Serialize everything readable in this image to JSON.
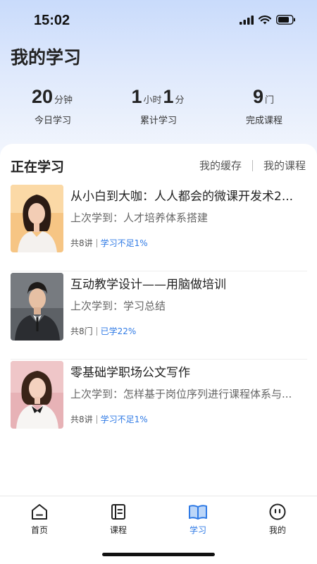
{
  "status_bar": {
    "time": "15:02"
  },
  "page_title": "我的学习",
  "stats": [
    {
      "parts": [
        {
          "num": "20"
        },
        {
          "unit": "分钟"
        }
      ],
      "label": "今日学习"
    },
    {
      "parts": [
        {
          "num": "1"
        },
        {
          "unit": "小时"
        },
        {
          "num": "1"
        },
        {
          "unit": "分"
        }
      ],
      "label": "累计学习"
    },
    {
      "parts": [
        {
          "num": "9"
        },
        {
          "unit": "门"
        }
      ],
      "label": "完成课程"
    }
  ],
  "section": {
    "title": "正在学习",
    "links": [
      "我的缓存",
      "我的课程"
    ]
  },
  "courses": [
    {
      "title": "从小白到大咖：人人都会的微课开发术2...",
      "last": "上次学到：人才培养体系搭建",
      "count": "共8讲",
      "progress": "学习不足1%",
      "thumb_bg": "#f7c98a"
    },
    {
      "title": "互动教学设计——用脑做培训",
      "last": "上次学到：学习总结",
      "count": "共8门",
      "progress": "已学22%",
      "thumb_bg": "#6c7075"
    },
    {
      "title": "零基础学职场公文写作",
      "last": "上次学到：怎样基于岗位序列进行课程体系与...",
      "count": "共8讲",
      "progress": "学习不足1%",
      "thumb_bg": "#e9b5b9"
    }
  ],
  "tabs": [
    {
      "label": "首页",
      "icon": "home-icon",
      "active": false
    },
    {
      "label": "课程",
      "icon": "course-icon",
      "active": false
    },
    {
      "label": "学习",
      "icon": "book-open-icon",
      "active": true
    },
    {
      "label": "我的",
      "icon": "profile-face-icon",
      "active": false
    }
  ],
  "colors": {
    "accent": "#2f7ae5",
    "header_gradient_top": "#c9dbfb"
  }
}
